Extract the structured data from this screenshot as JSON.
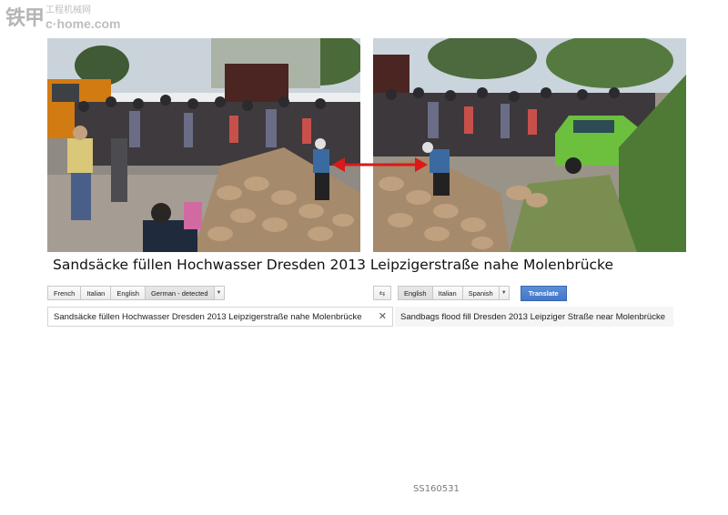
{
  "watermark": {
    "main": "铁甲",
    "top": "工程机械网",
    "bottom": "c·home.com"
  },
  "photos": {
    "left": {
      "icon": "flood-sandbag-photo-left"
    },
    "right": {
      "icon": "flood-sandbag-photo-right"
    },
    "connector": {
      "icon": "double-arrow-icon",
      "color": "#d81a1a"
    }
  },
  "caption": "Sandsäcke füllen Hochwasser Dresden 2013  Leipzigerstraße nahe Molenbrücke",
  "translator": {
    "source_langs": [
      "French",
      "Italian",
      "English",
      "German - detected"
    ],
    "target_langs": [
      "English",
      "Italian",
      "Spanish"
    ],
    "translate_label": "Translate",
    "source_text": "Sandsäcke füllen Hochwasser Dresden 2013  Leipzigerstraße nahe Molenbrücke",
    "output_text": "Sandbags flood fill Dresden 2013 Leipziger Straße near Molenbrücke",
    "accent": "#4a7fcf"
  },
  "footer": {
    "id": "SS160531"
  }
}
